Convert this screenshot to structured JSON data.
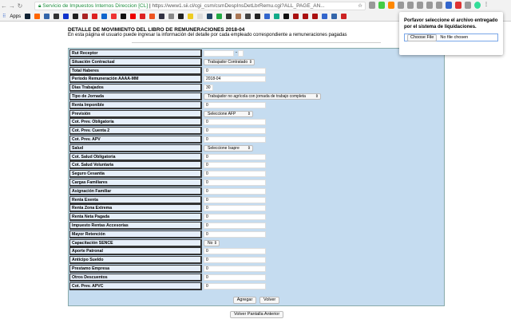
{
  "browser": {
    "security_label": "Servicio de Impuestos Internos Direccion [CL]",
    "url": "https://www1.sii.cl/cgi_csm/csmDespInsDetLbrRemu.cgi?ALL_PAGE_AN...",
    "apps_label": "Apps"
  },
  "page": {
    "title": "DETALLE DE MOVIMIENTO DEL LIBRO DE REMUNERACIONES 2018-04",
    "subtitle": "En esta página el usuario puede ingresar la información del detalle por cada empleado correspondiente a remuneraciones pagadas"
  },
  "rows": [
    {
      "label": "Rut Receptor",
      "type": "rut",
      "value": ""
    },
    {
      "label": "Situación Contractual",
      "type": "select",
      "value": "Trabajador Contratado"
    },
    {
      "label": "Total Haberes",
      "type": "input",
      "value": "0"
    },
    {
      "label": "Periodo Remuneración AAAA-MM",
      "type": "input",
      "value": "2018-04"
    },
    {
      "label": "Dias Trabajados",
      "type": "short",
      "value": "30"
    },
    {
      "label": "Tipo de Jornada",
      "type": "select",
      "value": "Trabajador no agrícola con jornada de trabajo completa"
    },
    {
      "label": "Renta Imponible",
      "type": "input",
      "value": "0"
    },
    {
      "label": "Previsión",
      "type": "select",
      "value": "Seleccione AFP"
    },
    {
      "label": "Cot. Prev. Obligatoria",
      "type": "input",
      "value": "0"
    },
    {
      "label": "Cot. Prev. Cuenta 2",
      "type": "input",
      "value": "0"
    },
    {
      "label": "Cot. Prev. APV",
      "type": "input",
      "value": "0"
    },
    {
      "label": "Salud",
      "type": "select",
      "value": "Seleccione Isapre"
    },
    {
      "label": "Cot. Salud Obligatoria",
      "type": "input",
      "value": "0"
    },
    {
      "label": "Cot. Salud Voluntaria",
      "type": "input",
      "value": "0"
    },
    {
      "label": "Seguro Cesantía",
      "type": "input",
      "value": "0"
    },
    {
      "label": "Cargas Familiares",
      "type": "input",
      "value": "0"
    },
    {
      "label": "Asignación Familiar",
      "type": "input",
      "value": "0"
    },
    {
      "label": "Renta Exenta",
      "type": "input",
      "value": "0"
    },
    {
      "label": "Renta Zona Extrema",
      "type": "input",
      "value": "0"
    },
    {
      "label": "Renta Neta Pagada",
      "type": "input",
      "value": "0"
    },
    {
      "label": "Impuesto Rentas Accesorias",
      "type": "input",
      "value": "0"
    },
    {
      "label": "Mayor Retención",
      "type": "input",
      "value": "0"
    },
    {
      "label": "Capacitación SENCE",
      "type": "select",
      "value": "No"
    },
    {
      "label": "Aporte Patronal",
      "type": "input",
      "value": "0"
    },
    {
      "label": "Anticipo Sueldo",
      "type": "input",
      "value": "0"
    },
    {
      "label": "Prestamo Empresa",
      "type": "input",
      "value": "0"
    },
    {
      "label": "Otros Descuentos",
      "type": "input",
      "value": "0"
    },
    {
      "label": "Cot. Prev. APVC",
      "type": "input",
      "value": "0"
    }
  ],
  "buttons": {
    "add": "Agregar",
    "back": "Volver",
    "back_previous": "Volver Pantalla Anterior"
  },
  "popup": {
    "message": "Porfavor seleccione el archivo entregado por el sistema de liquidaciones.",
    "choose_file": "Choose File",
    "no_file": "No file chosen"
  }
}
